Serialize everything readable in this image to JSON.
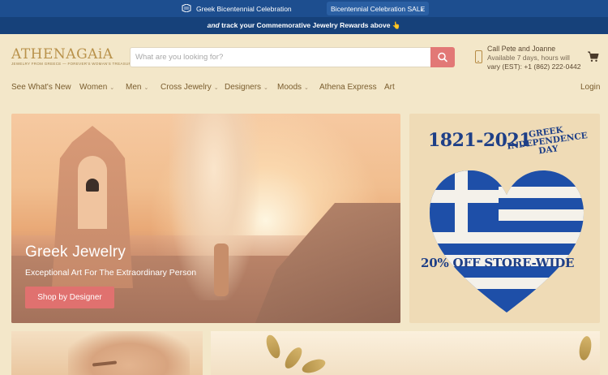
{
  "topbar": {
    "promo_text": "Greek Bicentennial Celebration",
    "select_value": "Bicentennial Celebration SALE"
  },
  "subbar": {
    "prefix": "and",
    "text": "track your Commemorative Jewelry Rewards above 👆"
  },
  "logo": {
    "wordmark": "ATHENAGAiA",
    "tagline": "JEWELRY FROM GREECE — FOREVER'S WOMAN'S TREASURES"
  },
  "search": {
    "placeholder": "What are you looking for?",
    "value": ""
  },
  "contact": {
    "title": "Call Pete and Joanne",
    "hours": "Available 7 days, hours will",
    "phone": "vary (EST): +1 (862) 222-0442"
  },
  "nav": {
    "items": [
      {
        "label": "See What's New"
      },
      {
        "label": "Women"
      },
      {
        "label": "Men"
      },
      {
        "label": "Cross Jewelry"
      },
      {
        "label": "Designers"
      },
      {
        "label": "Moods"
      },
      {
        "label": "Athena Express"
      },
      {
        "label": "Art"
      }
    ],
    "login": "Login"
  },
  "hero": {
    "heading": "Greek Jewelry",
    "subheading": "Exceptional Art For The Extraordinary Person",
    "cta": "Shop by Designer"
  },
  "promo_card": {
    "years": "1821-2021",
    "title": "GREEK INDEPENDENCE DAY",
    "offer": "20% OFF STORE-WIDE"
  },
  "colors": {
    "topbar": "#1d4e8f",
    "subbar": "#16417a",
    "accent": "#e27876",
    "nav_text": "#7a5d2e",
    "greek_blue": "#1e3f87"
  },
  "icons": {
    "topbar": "flag-icon",
    "search": "search-icon",
    "phone": "phone-icon",
    "cart": "cart-icon",
    "select": "chevron-down-icon",
    "nav_caret": "caret-down-icon"
  }
}
